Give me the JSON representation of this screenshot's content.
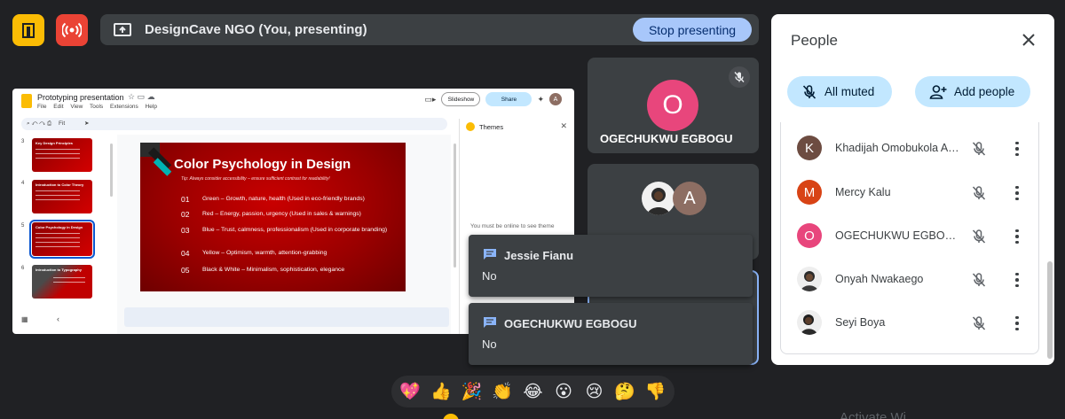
{
  "topbar": {
    "presenting_text": "DesignCave NGO (You, presenting)",
    "stop_label": "Stop presenting"
  },
  "slides_app": {
    "doc_title": "Prototyping presentation",
    "menu": [
      "File",
      "Edit",
      "View",
      "Tools",
      "Extensions",
      "Help"
    ],
    "zoom": "Fit",
    "slideshow_label": "Slideshow",
    "share_label": "Share",
    "avatar_letter": "A",
    "themes_title": "Themes",
    "themes_message": "You must be online to see theme",
    "thumbnails": [
      {
        "num": "3",
        "title": "Key Design Principles"
      },
      {
        "num": "4",
        "title": "Introduction to Color Theory"
      },
      {
        "num": "5",
        "title": "Color Psychology in Design"
      },
      {
        "num": "6",
        "title": "Introduction to Typography"
      }
    ],
    "slide": {
      "title": "Color Psychology in Design",
      "tip": "Tip: Always consider accessibility – ensure sufficient contrast for readability!",
      "items": [
        {
          "num": "01",
          "text": "Green – Growth, nature, health (Used in eco-friendly brands)"
        },
        {
          "num": "02",
          "text": "Red – Energy, passion, urgency (Used in sales & warnings)"
        },
        {
          "num": "03",
          "text": "Blue – Trust, calmness, professionalism (Used in corporate branding)"
        },
        {
          "num": "04",
          "text": "Yellow – Optimism, warmth, attention-grabbing"
        },
        {
          "num": "05",
          "text": "Black & White – Minimalism, sophistication, elegance"
        }
      ]
    }
  },
  "tiles": {
    "tile1_initial": "O",
    "tile1_name": "OGECHUKWU EGBOGU",
    "tile2_initial": "A"
  },
  "chat": [
    {
      "sender": "Jessie Fianu",
      "message": "No"
    },
    {
      "sender": "OGECHUKWU EGBOGU",
      "message": "No"
    }
  ],
  "people_panel": {
    "title": "People",
    "all_muted_label": "All muted",
    "add_people_label": "Add people",
    "participants": [
      {
        "initial": "K",
        "name": "Khadijah Omobukola Al...",
        "color": "#6d4c41"
      },
      {
        "initial": "M",
        "name": "Mercy Kalu",
        "color": "#d84315"
      },
      {
        "initial": "O",
        "name": "OGECHUKWU EGBOGU",
        "color": "#e8467c"
      },
      {
        "initial": "",
        "name": "Onyah Nwakaego",
        "color": "#eeeeee"
      },
      {
        "initial": "",
        "name": "Seyi Boya",
        "color": "#eeeeee"
      }
    ]
  },
  "reactions": [
    "💖",
    "👍",
    "🎉",
    "👏",
    "😂",
    "😮",
    "😢",
    "🤔",
    "👎"
  ],
  "watermark": "Activate Wi"
}
